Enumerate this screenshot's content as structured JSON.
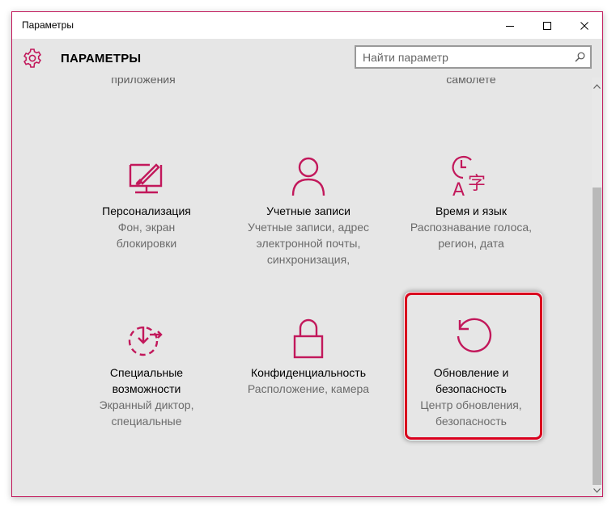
{
  "window": {
    "title": "Параметры",
    "accent": "#c2185b"
  },
  "header": {
    "app_title": "ПАРАМЕТРЫ",
    "search_placeholder": "Найти параметр"
  },
  "partial_row": {
    "left_text": "приложения",
    "right_text": "самолете"
  },
  "tiles": [
    {
      "icon": "personalization-icon",
      "title": "Персонализация",
      "desc": [
        "Фон, экран",
        "блокировки"
      ]
    },
    {
      "icon": "accounts-icon",
      "title": "Учетные записи",
      "desc": [
        "Учетные записи, адрес",
        "электронной почты,",
        "синхронизация,"
      ]
    },
    {
      "icon": "time-language-icon",
      "title": "Время и язык",
      "desc": [
        "Распознавание голоса,",
        "регион, дата"
      ]
    },
    {
      "icon": "ease-of-access-icon",
      "title": "Специальные возможности",
      "title_lines": [
        "Специальные",
        "возможности"
      ],
      "desc": [
        "Экранный диктор,",
        "специальные"
      ]
    },
    {
      "icon": "privacy-lock-icon",
      "title": "Конфиденциальность",
      "desc": [
        "Расположение, камера"
      ]
    },
    {
      "icon": "update-security-icon",
      "title": "Обновление и безопасность",
      "title_lines": [
        "Обновление и",
        "безопасность"
      ],
      "desc": [
        "Центр обновления,",
        "безопасность"
      ]
    }
  ],
  "highlight_color": "#d9001d"
}
